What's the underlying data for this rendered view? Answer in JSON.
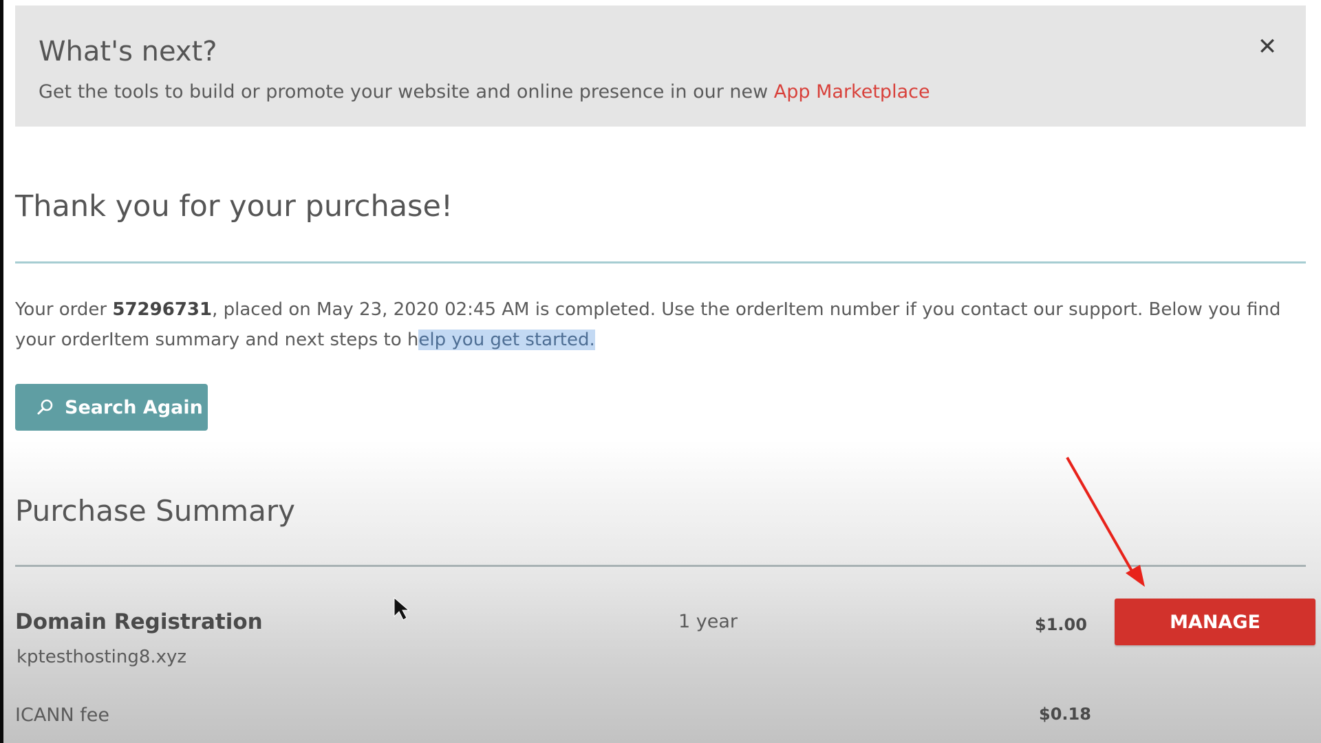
{
  "banner": {
    "title": "What's next?",
    "text": "Get the tools to build or promote your website and online presence in our new ",
    "link_label": "App Marketplace",
    "close_label": "✕"
  },
  "confirmation": {
    "title": "Thank you for your purchase!",
    "order_prefix": "Your order ",
    "order_number": "57296731",
    "order_suffix": ", placed on May 23, 2020 02:45 AM is completed. Use the orderItem number if you contact our support. Below you find",
    "line2_plain": "your orderItem summary and next steps to h",
    "line2_highlight": "elp you get started."
  },
  "search_button": {
    "label": "Search Again",
    "icon": "search-icon"
  },
  "summary": {
    "title": "Purchase Summary",
    "items": [
      {
        "name": "Domain Registration",
        "domain": "kptesthosting8.xyz",
        "term": "1 year",
        "price": "$1.00",
        "action_label": "MANAGE"
      },
      {
        "name": "ICANN fee",
        "price": "$0.18"
      }
    ]
  },
  "colors": {
    "banner_bg": "#e5e5e5",
    "link": "#d8403a",
    "teal_button": "#5f9ea3",
    "manage_button": "#d2322c",
    "annotation_arrow": "#e8231b",
    "highlight": "#c3d9f3"
  },
  "annotations": {
    "arrow_color": "#e8231b",
    "arrow_target": "manage-button"
  }
}
